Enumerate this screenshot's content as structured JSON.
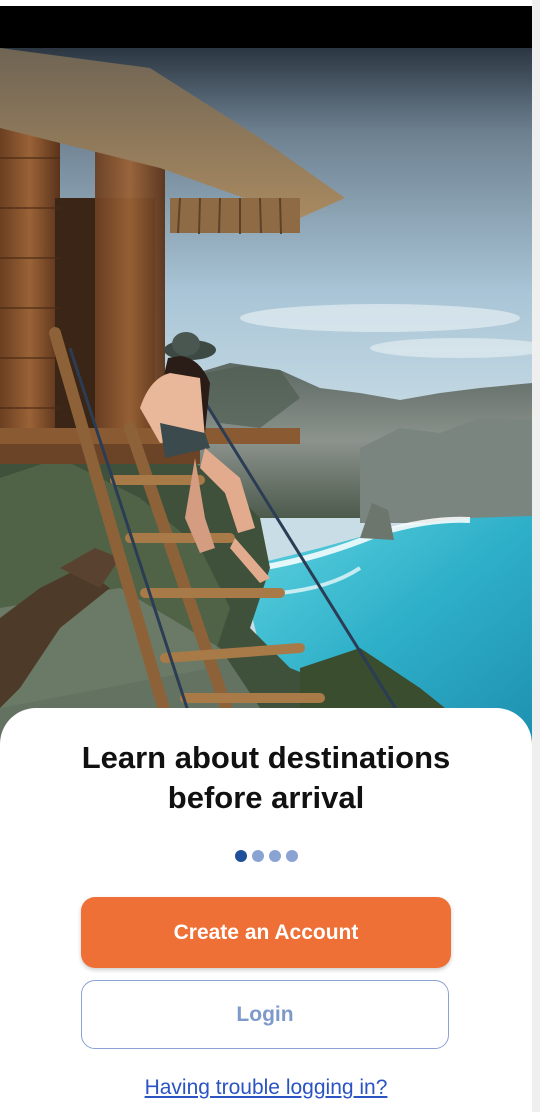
{
  "onboarding": {
    "headline_line1": "Learn about destinations",
    "headline_line2": "before arrival",
    "pager": {
      "total": 4,
      "active_index": 0
    },
    "create_account_label": "Create an Account",
    "login_label": "Login",
    "trouble_link": "Having trouble logging in?"
  },
  "colors": {
    "primary_button": "#ee7036",
    "login_border": "#8aa3d3",
    "login_text": "#7d9acb",
    "dot_active": "#1f4f99",
    "dot_inactive": "#8aa3d3",
    "link": "#2a53c4"
  }
}
